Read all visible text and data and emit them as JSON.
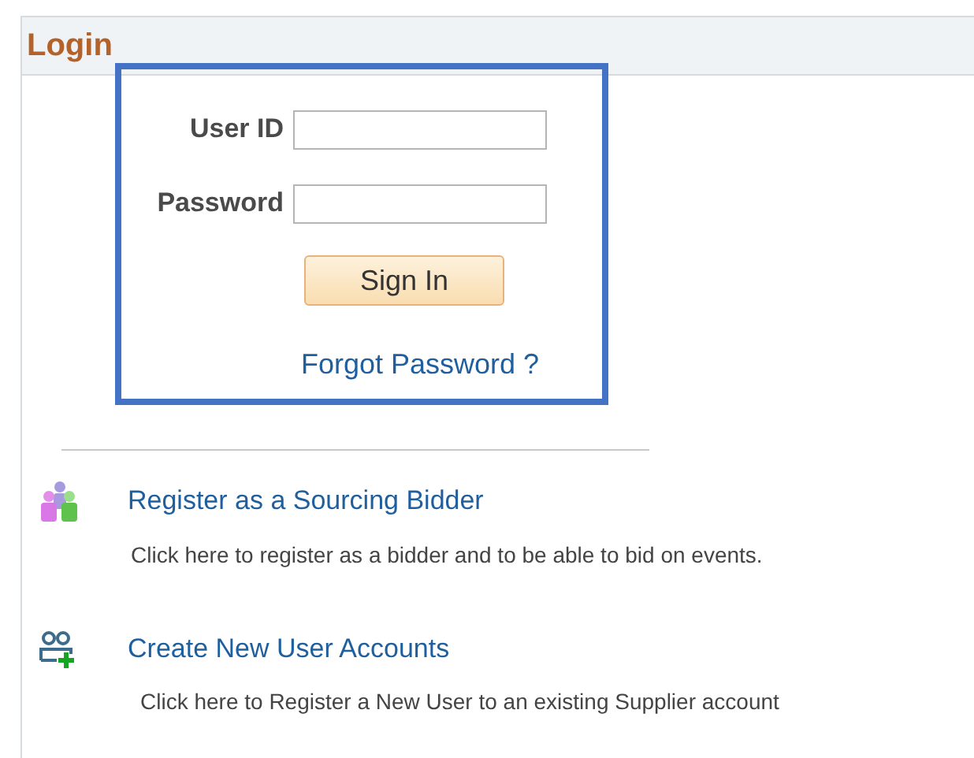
{
  "panel": {
    "title": "Login"
  },
  "login_form": {
    "fields": [
      {
        "label": "User ID"
      },
      {
        "label": "Password"
      }
    ],
    "sign_in_button": "Sign In",
    "forgot_link": "Forgot Password ?"
  },
  "links": [
    {
      "kind": "bidder",
      "title": "Register as a Sourcing Bidder",
      "description": "Click here to register as a bidder and to be able to bid on events."
    },
    {
      "kind": "accounts",
      "title": "Create New User Accounts",
      "description": "Click here to Register a New User to an existing Supplier account"
    }
  ]
}
